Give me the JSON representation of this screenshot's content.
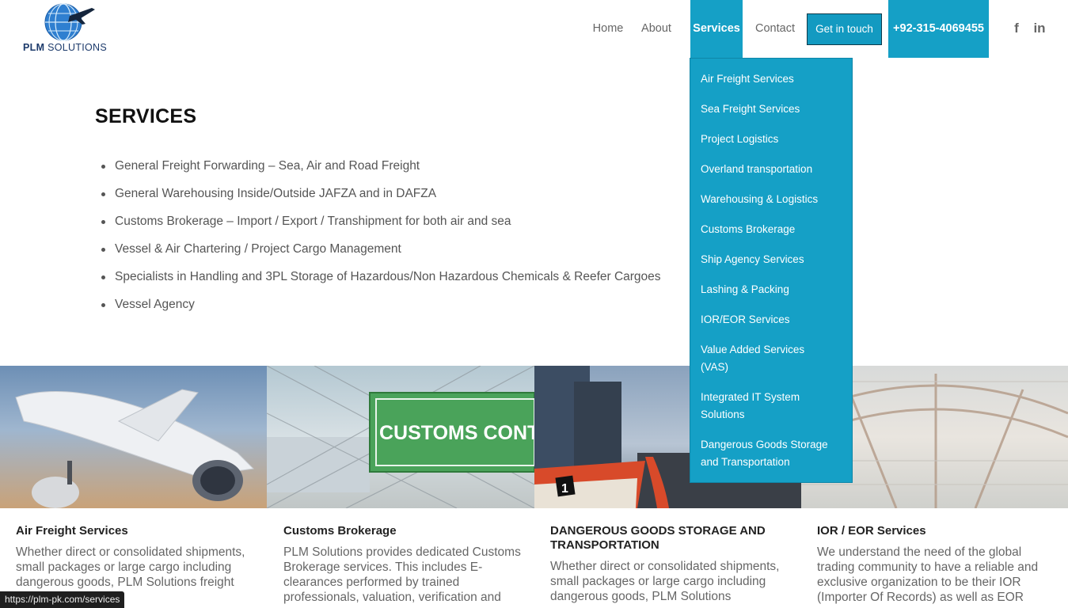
{
  "logo": {
    "brand_bold": "PLM",
    "brand_rest": " SOLUTIONS"
  },
  "nav": {
    "home": "Home",
    "about": "About",
    "services": "Services",
    "contact": "Contact",
    "get_in_touch": "Get in touch",
    "phone": "+92-315-4069455",
    "social": {
      "facebook": "f",
      "linkedin": "in"
    }
  },
  "main": {
    "title": "SERVICES",
    "items": [
      "General Freight Forwarding – Sea, Air and Road Freight",
      "General Warehousing Inside/Outside JAFZA and in DAFZA",
      "Customs Brokerage – Import / Export / Transhipment for both air and sea",
      "Vessel & Air Chartering / Project Cargo Management",
      "Specialists in Handling and 3PL Storage of Hazardous/Non Hazardous Chemicals & Reefer Cargoes",
      "Vessel Agency"
    ]
  },
  "dropdown": {
    "items": [
      "Air Freight Services",
      "Sea Freight Services",
      "Project Logistics",
      "Overland transportation",
      "Warehousing & Logistics",
      "Customs Brokerage",
      "Ship Agency Services",
      "Lashing & Packing",
      "IOR/EOR Services",
      "Value Added Services (VAS)",
      "Integrated IT System Solutions",
      "Dangerous Goods Storage and Transportation"
    ]
  },
  "tiles": {
    "customs_sign": "CUSTOMS CONTROL",
    "boat_number": "1"
  },
  "cards": [
    {
      "title": "Air Freight Services",
      "text": "Whether direct or consolidated shipments, small packages or large cargo including dangerous goods, PLM Solutions freight needs."
    },
    {
      "title": "Customs Brokerage",
      "text": "PLM Solutions provides dedicated Customs Brokerage services. This includes E-clearances performed by trained professionals, valuation, verification and"
    },
    {
      "title": "DANGEROUS GOODS STORAGE AND TRANSPORTATION",
      "text": "Whether direct or consolidated shipments, small packages or large cargo including dangerous goods, PLM Solutions"
    },
    {
      "title": "IOR / EOR Services",
      "text": "We understand the need of the global trading community to have a reliable and exclusive organization to be their IOR (Importer Of Records) as well as EOR"
    }
  ],
  "status_bar": {
    "url": "https://plm-pk.com/services"
  },
  "colors": {
    "accent": "#15a0c6",
    "text": "#555555",
    "title": "#111111"
  }
}
